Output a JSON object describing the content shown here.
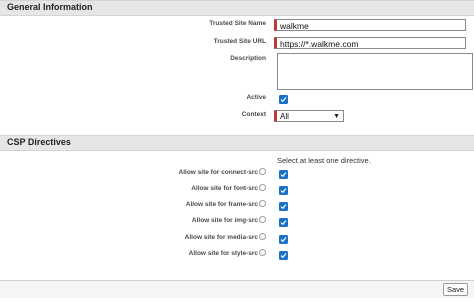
{
  "general": {
    "title": "General Information",
    "trusted_site_name_label": "Trusted Site Name",
    "trusted_site_name_value": "walkme",
    "trusted_site_url_label": "Trusted Site URL",
    "trusted_site_url_value": "https://*.walkme.com",
    "description_label": "Description",
    "description_value": "",
    "active_label": "Active",
    "active_checked": true,
    "context_label": "Context",
    "context_value": "All"
  },
  "csp": {
    "title": "CSP Directives",
    "instruction": "Select at least one directive.",
    "directives": [
      {
        "label": "Allow site for connect-src",
        "checked": true
      },
      {
        "label": "Allow site for font-src",
        "checked": true
      },
      {
        "label": "Allow site for frame-src",
        "checked": true
      },
      {
        "label": "Allow site for img-src",
        "checked": true
      },
      {
        "label": "Allow site for media-src",
        "checked": true
      },
      {
        "label": "Allow site for style-src",
        "checked": true
      }
    ]
  },
  "footer": {
    "save_label": "Save"
  },
  "icons": {
    "top_icon": "drag-handle-icon",
    "help_icon": "help-info-icon",
    "checkbox": "checkmark-icon",
    "select_arrow": "chevron-down-icon"
  },
  "colors": {
    "required_bar": "#c23934",
    "checkbox_blue": "#1a73c8",
    "section_header_bg": "#e6e6e6"
  }
}
